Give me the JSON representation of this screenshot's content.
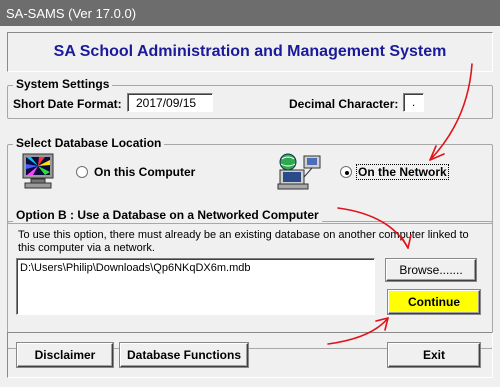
{
  "window": {
    "title": "SA-SAMS (Ver 17.0.0)"
  },
  "header": {
    "title": "SA School Administration and Management System"
  },
  "system_settings": {
    "group_title": "System Settings",
    "short_date_label": "Short Date Format:",
    "short_date_value": "2017/09/15",
    "decimal_label": "Decimal Character:",
    "decimal_value": "."
  },
  "database_location": {
    "group_title": "Select Database Location",
    "options": [
      {
        "label": "On this Computer",
        "selected": false
      },
      {
        "label": "On the Network",
        "selected": true
      }
    ]
  },
  "network_option": {
    "group_title": "Option B : Use a Database on a Networked Computer",
    "description": "To use this option, there must already be an existing database on another computer linked to this computer via a network.",
    "path_value": "D:\\Users\\Philip\\Downloads\\Qp6NKqDX6m.mdb",
    "browse_label": "Browse.......",
    "continue_label": "Continue",
    "continue_color": "#ffff00"
  },
  "footer": {
    "disclaimer_label": "Disclaimer",
    "database_functions_label": "Database Functions",
    "exit_label": "Exit"
  },
  "annotation_color": "#e0141a",
  "icons": [
    "computer-icon",
    "network-computer-icon"
  ]
}
